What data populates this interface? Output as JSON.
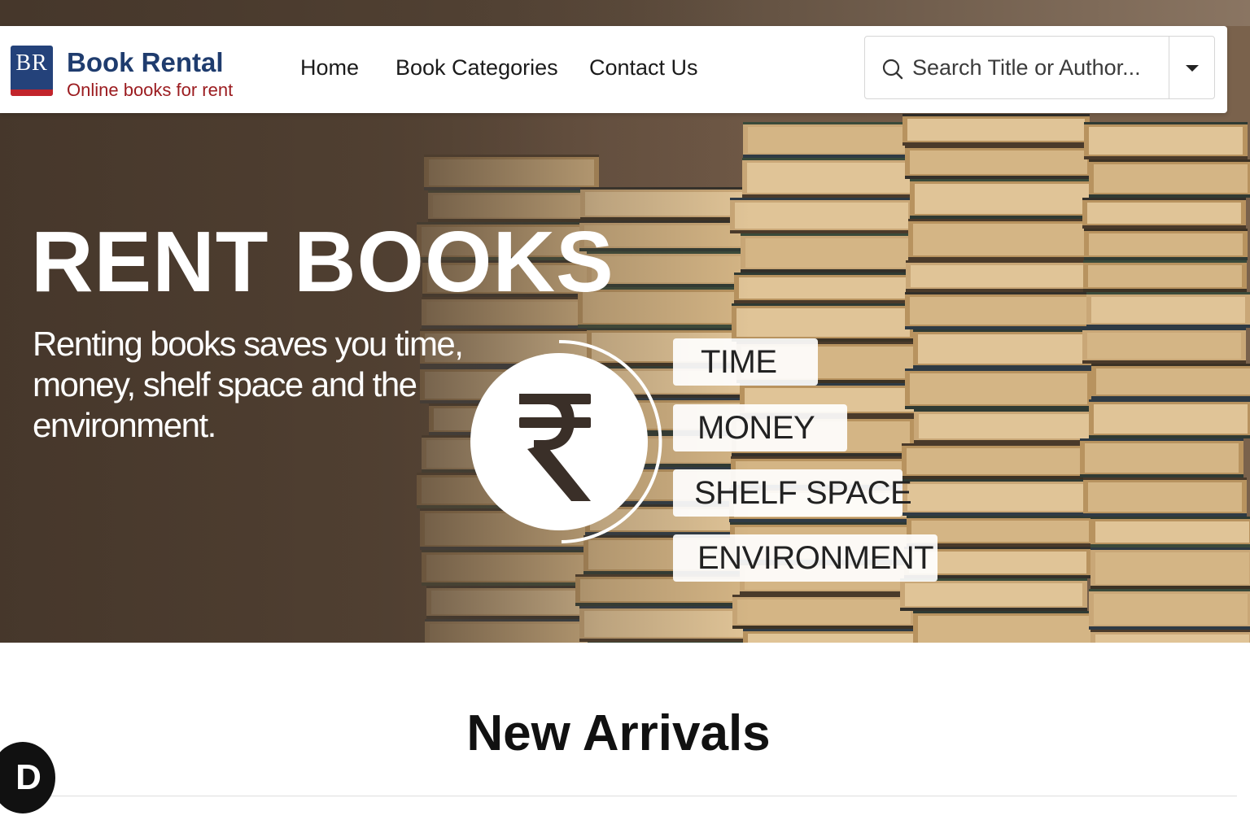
{
  "brand": {
    "logo_letters": "BR",
    "title": "Book Rental",
    "subtitle": "Online books for rent",
    "colors": {
      "primary": "#1f3c6e",
      "accent": "#9b1b1f"
    }
  },
  "nav": {
    "items": [
      {
        "label": "Home"
      },
      {
        "label": "Book Categories"
      },
      {
        "label": "Contact Us"
      }
    ]
  },
  "search": {
    "placeholder": "Search Title or Author...",
    "icon": "search-icon",
    "dropdown_icon": "chevron-down-icon"
  },
  "hero": {
    "title": "RENT BOOKS",
    "description": "Renting books saves you time, money, shelf space and the environment.",
    "symbol": "₹",
    "tags": [
      "TIME",
      "MONEY",
      "SHELF SPACE",
      "ENVIRONMENT"
    ]
  },
  "new_arrivals": {
    "title": "New Arrivals"
  },
  "floating_badge": {
    "letter": "D"
  }
}
